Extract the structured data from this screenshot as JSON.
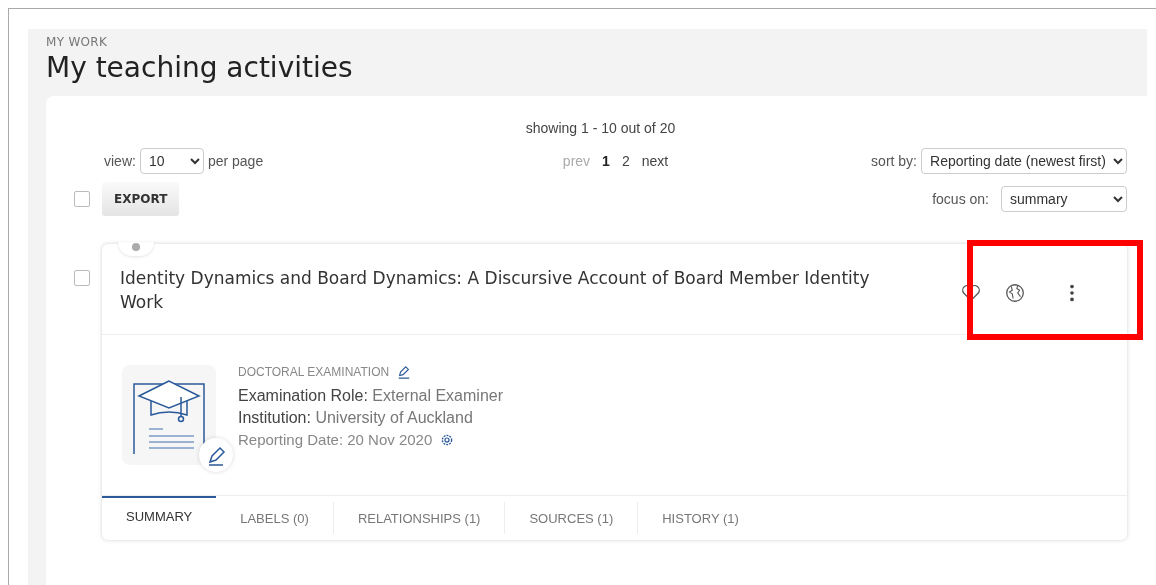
{
  "header": {
    "eyebrow": "MY WORK",
    "title": "My teaching activities"
  },
  "toolbar": {
    "showing": "showing 1 - 10 out of 20",
    "view_label": "view:",
    "per_page": "10",
    "per_page_suffix": "per page",
    "pagination": [
      {
        "label": "prev",
        "disabled": true,
        "selected": false
      },
      {
        "label": "1",
        "disabled": false,
        "selected": true
      },
      {
        "label": "2",
        "disabled": false,
        "selected": false
      },
      {
        "label": "next",
        "disabled": false,
        "selected": false
      }
    ],
    "sort_label": "sort by:",
    "sort_value": "Reporting date (newest first)",
    "select_all_checked": false,
    "export_button": "EXPORT",
    "focus_label": "focus on:",
    "focus_value": "summary"
  },
  "record": {
    "checked": false,
    "title": "Identity Dynamics and Board Dynamics: A Discursive Account of Board Member Identity Work",
    "highlighted_actions": true,
    "type": "DOCTORAL EXAMINATION",
    "fields": [
      {
        "label": "Examination Role:",
        "value": "External Examiner",
        "kind": "strong"
      },
      {
        "label": "Institution:",
        "value": "University of Auckland",
        "kind": "strong"
      },
      {
        "label": "Reporting Date:",
        "value": "20 Nov 2020",
        "kind": "date"
      }
    ],
    "tabs": [
      {
        "label": "SUMMARY",
        "selected": true
      },
      {
        "label": "LABELS (0)",
        "selected": false
      },
      {
        "label": "RELATIONSHIPS (1)",
        "selected": false
      },
      {
        "label": "SOURCES (1)",
        "selected": false
      },
      {
        "label": "HISTORY (1)",
        "selected": false
      }
    ]
  }
}
